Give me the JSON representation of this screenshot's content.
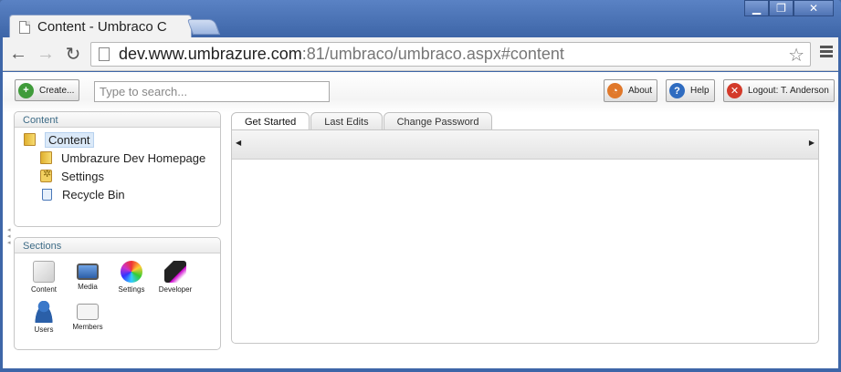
{
  "browser": {
    "tab_title": "Content - Umbraco C",
    "url_host": "dev.www.umbrazure.com",
    "url_rest": ":81/umbraco/umbraco.aspx#content",
    "window_buttons": [
      "▁",
      "❐",
      "✕"
    ]
  },
  "toolbar": {
    "create_label": "Create...",
    "search_placeholder": "Type to search...",
    "about_label": "About",
    "help_label": "Help",
    "logout_label": "Logout: T. Anderson"
  },
  "content_panel": {
    "title": "Content",
    "tree": {
      "root": "Content",
      "children": [
        "Umbrazure Dev Homepage",
        "Settings",
        "Recycle Bin"
      ]
    }
  },
  "sections_panel": {
    "title": "Sections",
    "items": [
      "Content",
      "Media",
      "Settings",
      "Developer",
      "Users",
      "Members"
    ]
  },
  "main_tabs": [
    "Get Started",
    "Last Edits",
    "Change Password"
  ],
  "colors": {
    "create_icon": "#3f9b3a",
    "about_icon": "#e0782a",
    "help_icon": "#2f6cc0",
    "logout_icon": "#d33a2a"
  }
}
